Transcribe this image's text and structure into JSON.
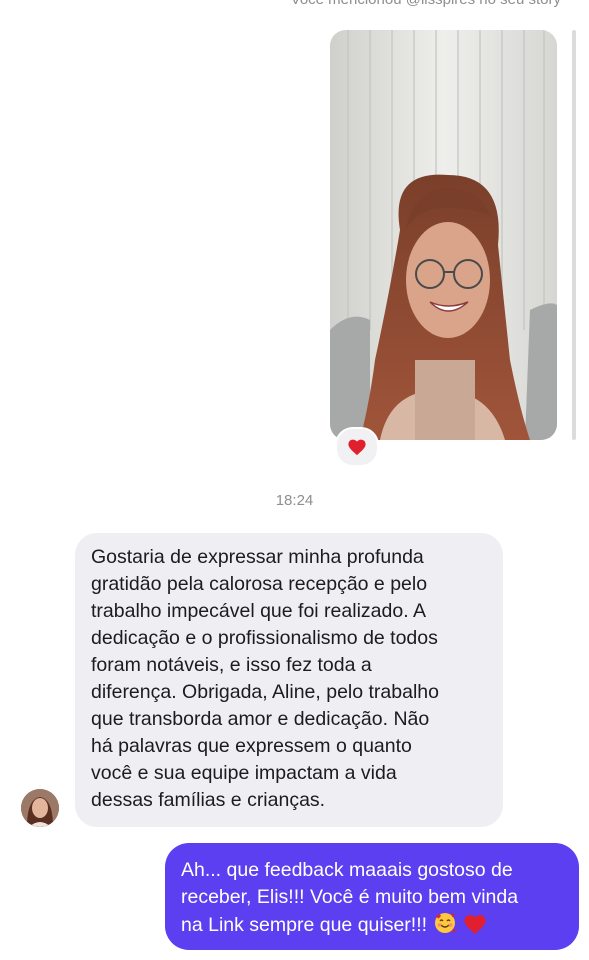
{
  "story": {
    "caption": "Você mencionou @lisspires no seu story",
    "reaction_icon": "heart-icon"
  },
  "thread": {
    "timestamp": "18:24"
  },
  "messages": {
    "received": {
      "avatar_icon": "contact-avatar",
      "lines": [
        "Gostaria de expressar minha profunda",
        "gratidão pela calorosa recepção e pelo",
        "trabalho impecável que foi realizado. A",
        "dedicação e o profissionalismo de todos",
        "foram notáveis, e isso fez toda a",
        "diferença. Obrigada, Aline, pelo trabalho",
        "que transborda amor e dedicação. Não",
        "há palavras que expressem o quanto",
        "você e sua equipe impactam a vida",
        "dessas famílias e crianças."
      ]
    },
    "sent": {
      "lines": [
        "Ah... que feedback maaais gostoso de",
        "receber, Elis!!! Você é muito bem vinda",
        "na Link sempre que quiser!!!"
      ],
      "emojis": [
        "smiling-face-with-hearts-icon",
        "red-heart-icon"
      ]
    }
  },
  "colors": {
    "sent_bubble": "#5b3ff0",
    "received_bubble": "#efeff3",
    "meta_text": "#8e8e93",
    "heart": "#e0202e"
  }
}
